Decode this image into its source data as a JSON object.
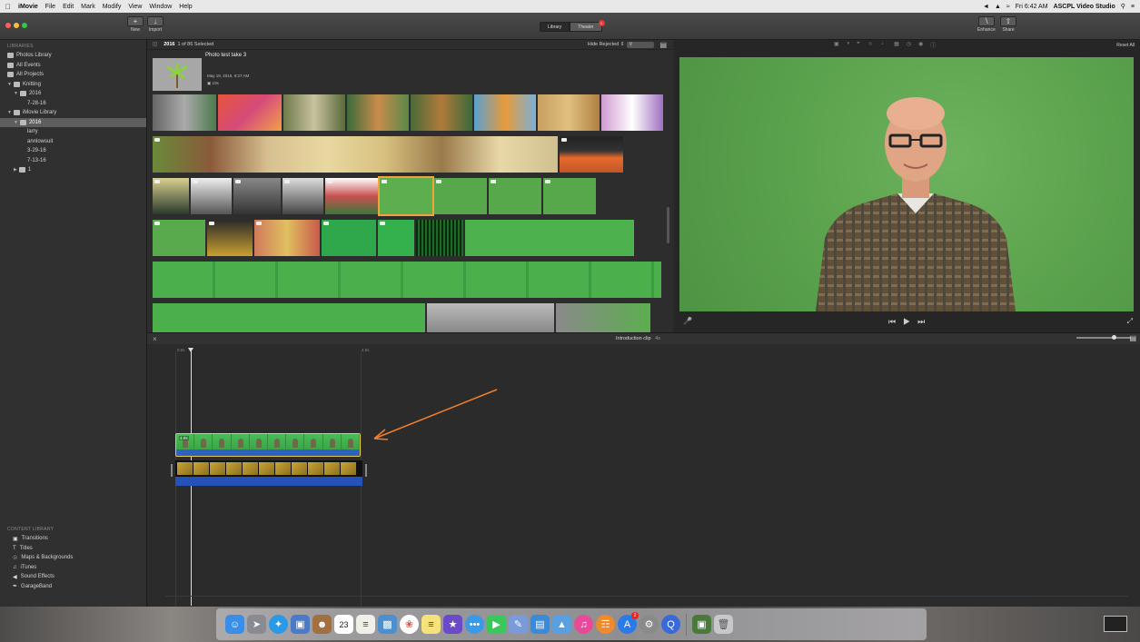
{
  "menubar": {
    "app": "iMovie",
    "items": [
      "File",
      "Edit",
      "Mark",
      "Modify",
      "View",
      "Window",
      "Help"
    ],
    "clock": "Fri 6:42 AM",
    "user": "ASCPL Video Studio"
  },
  "toolbar": {
    "new_label": "New",
    "import_label": "Import",
    "library_tab": "Library",
    "theater_tab": "Theater",
    "theater_badge": "1",
    "enhance_label": "Enhance",
    "share_label": "Share"
  },
  "sidebar": {
    "libraries_header": "LIBRARIES",
    "items": [
      {
        "label": "Photos Library",
        "icon": "photos-icon",
        "level": 0
      },
      {
        "label": "All Events",
        "icon": "events-icon",
        "level": 0
      },
      {
        "label": "All Projects",
        "icon": "projects-icon",
        "level": 0
      },
      {
        "label": "Knitting",
        "icon": "library-icon",
        "level": 0
      },
      {
        "label": "2016",
        "icon": "folder-icon",
        "level": 1
      },
      {
        "label": "7-28-16",
        "icon": "",
        "level": 2
      },
      {
        "label": "iMovie Library",
        "icon": "library-icon",
        "level": 0
      },
      {
        "label": "2016",
        "icon": "folder-icon",
        "level": 1,
        "selected": true
      },
      {
        "label": "larry",
        "icon": "",
        "level": 2
      },
      {
        "label": "annlowsuit",
        "icon": "",
        "level": 2
      },
      {
        "label": "3-29-16",
        "icon": "",
        "level": 2
      },
      {
        "label": "7-13-16",
        "icon": "",
        "level": 2
      },
      {
        "label": "1",
        "icon": "folder-icon",
        "level": 1
      }
    ],
    "content_header": "CONTENT LIBRARY",
    "content_items": [
      {
        "label": "Transitions",
        "icon": "transitions-icon"
      },
      {
        "label": "Titles",
        "icon": "titles-icon"
      },
      {
        "label": "Maps & Backgrounds",
        "icon": "globe-icon"
      },
      {
        "label": "iTunes",
        "icon": "music-note-icon"
      },
      {
        "label": "Sound Effects",
        "icon": "speaker-icon"
      },
      {
        "label": "GarageBand",
        "icon": "guitar-icon"
      }
    ]
  },
  "browser": {
    "event_name": "2016",
    "selection_count": "1 of 86 Selected",
    "filter": "Hide Rejected",
    "photo_title": "Photo test take 3",
    "photo_date": "May 19, 2016, 8:27 AM",
    "photo_duration": "10s"
  },
  "viewer": {
    "reset_label": "Reset All"
  },
  "timeline": {
    "project_title": "Introduction clip",
    "project_duration": "4s",
    "ruler_start": "0.0s",
    "ruler_mark": "4.0s",
    "clip_duration": "4.0s"
  },
  "colors": {
    "accent_arrow": "#f07f2d",
    "selection_yellow": "#e6c84a",
    "greenscreen": "#5aa14c"
  },
  "dock": {
    "calendar_date": "23",
    "appstore_badge": "2"
  }
}
